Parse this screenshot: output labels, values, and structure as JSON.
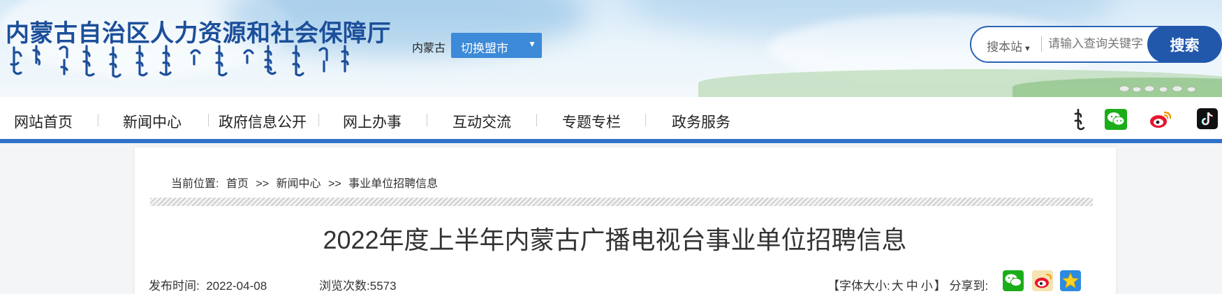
{
  "site": {
    "title": "内蒙古自治区人力资源和社会保障厅"
  },
  "header": {
    "region_label": "内蒙古",
    "city_switch_label": "切换盟市",
    "search_scope": "搜本站",
    "search_placeholder": "请输入查询关键字",
    "search_button": "搜索"
  },
  "nav": {
    "items": [
      {
        "label": "网站首页"
      },
      {
        "label": "新闻中心"
      },
      {
        "label": "政府信息公开"
      },
      {
        "label": "网上办事"
      },
      {
        "label": "互动交流"
      },
      {
        "label": "专题专栏"
      },
      {
        "label": "政务服务"
      }
    ],
    "icons": [
      "mongolian-script-icon",
      "wechat-icon",
      "weibo-icon",
      "douyin-icon"
    ]
  },
  "breadcrumb": {
    "prefix": "当前位置:",
    "items": [
      "首页",
      "新闻中心",
      "事业单位招聘信息"
    ],
    "separator": ">>"
  },
  "article": {
    "title": "2022年度上半年内蒙古广播电视台事业单位招聘信息",
    "publish_label": "发布时间:",
    "publish_date": "2022-04-08",
    "views_label": "浏览次数:",
    "views": "5573",
    "font_size_label_open": "【字体大小:",
    "font_sizes": [
      "大",
      "中",
      "小"
    ],
    "font_size_label_close": "】",
    "share_label": "分享到:"
  },
  "share": {
    "icons": [
      "wechat-share-icon",
      "weibo-share-icon",
      "qzone-share-icon"
    ]
  },
  "colors": {
    "brand_blue": "#1c4f9a",
    "nav_border": "#2f73c8",
    "search_button": "#2158ac",
    "city_select": "#3c8ad8"
  }
}
